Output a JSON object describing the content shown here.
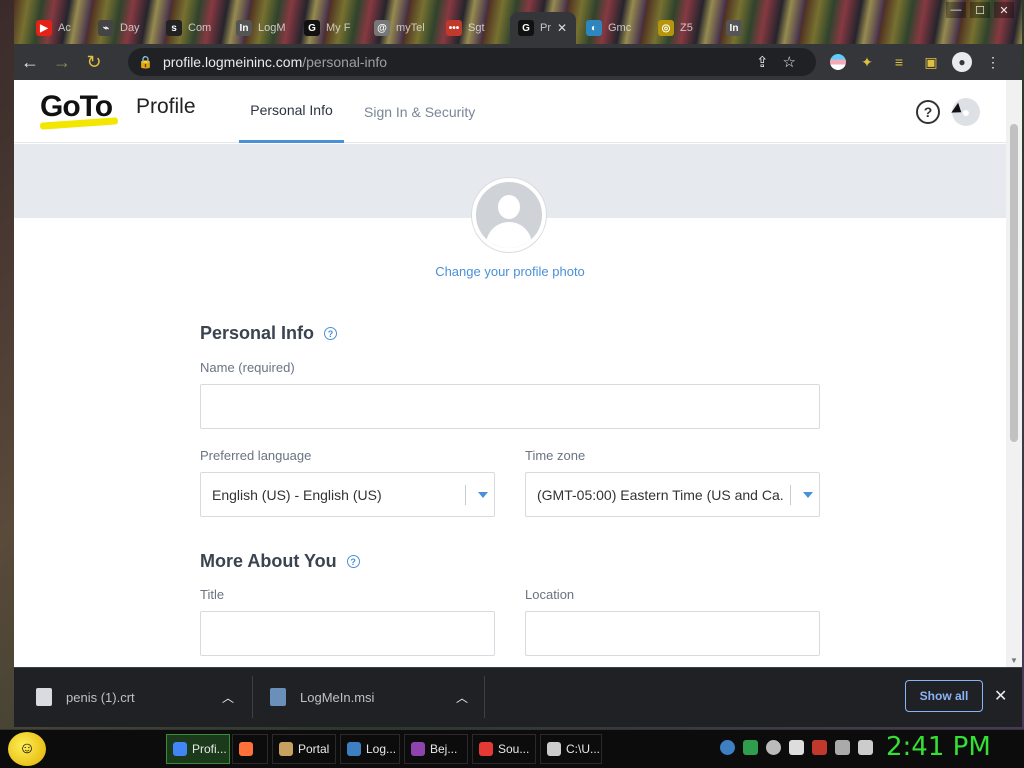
{
  "browser": {
    "tabs": [
      {
        "title": "Ac",
        "fav_color": "#e62117",
        "fav_glyph": "▶"
      },
      {
        "title": "Day",
        "fav_color": "#444",
        "fav_glyph": "⌁"
      },
      {
        "title": "Com",
        "fav_color": "#222",
        "fav_glyph": "s"
      },
      {
        "title": "LogM",
        "fav_color": "#555",
        "fav_glyph": "In"
      },
      {
        "title": "My F",
        "fav_color": "#111",
        "fav_glyph": "G"
      },
      {
        "title": "myTel",
        "fav_color": "#777",
        "fav_glyph": "@"
      },
      {
        "title": "Sgt",
        "fav_color": "#c0392b",
        "fav_glyph": "•••"
      },
      {
        "title": "Pr",
        "fav_color": "#111",
        "fav_glyph": "G"
      },
      {
        "title": "Gmc",
        "fav_color": "#2e86c1",
        "fav_glyph": "◐"
      },
      {
        "title": "Z5",
        "fav_color": "#b7950b",
        "fav_glyph": "◎"
      },
      {
        "title": "",
        "fav_color": "#555",
        "fav_glyph": "In"
      }
    ],
    "active_tab_index": 7,
    "url_host": "profile.logmeininc.com",
    "url_path": "/personal-info"
  },
  "header": {
    "logo": "GoTo",
    "title": "Profile",
    "tabs": [
      {
        "label": "Personal Info"
      },
      {
        "label": "Sign In & Security"
      }
    ],
    "help_glyph": "?"
  },
  "photo": {
    "change_label": "Change your profile photo"
  },
  "personal_info": {
    "title": "Personal Info",
    "name_label": "Name (required)",
    "name_value": "",
    "language_label": "Preferred language",
    "language_value": "English (US) - English (US)",
    "timezone_label": "Time zone",
    "timezone_value": "(GMT-05:00) Eastern Time (US and Ca..."
  },
  "more_about": {
    "title": "More About You",
    "title_label": "Title",
    "title_value": "",
    "location_label": "Location",
    "location_value": ""
  },
  "downloads": {
    "items": [
      {
        "name": "penis (1).crt"
      },
      {
        "name": "LogMeIn.msi"
      }
    ],
    "show_all": "Show all"
  },
  "taskbar": {
    "tasks": [
      {
        "label": "Profi...",
        "color": "#4285f4"
      },
      {
        "label": "",
        "color": "#ff7139"
      },
      {
        "label": "Portal",
        "color": "#c8a060"
      },
      {
        "label": "Log...",
        "color": "#3d7fc1"
      },
      {
        "label": "Bej...",
        "color": "#8e44ad"
      },
      {
        "label": "Sou...",
        "color": "#e53935"
      },
      {
        "label": "C:\\U...",
        "color": "#cccccc"
      }
    ],
    "clock": "2:41 PM"
  }
}
